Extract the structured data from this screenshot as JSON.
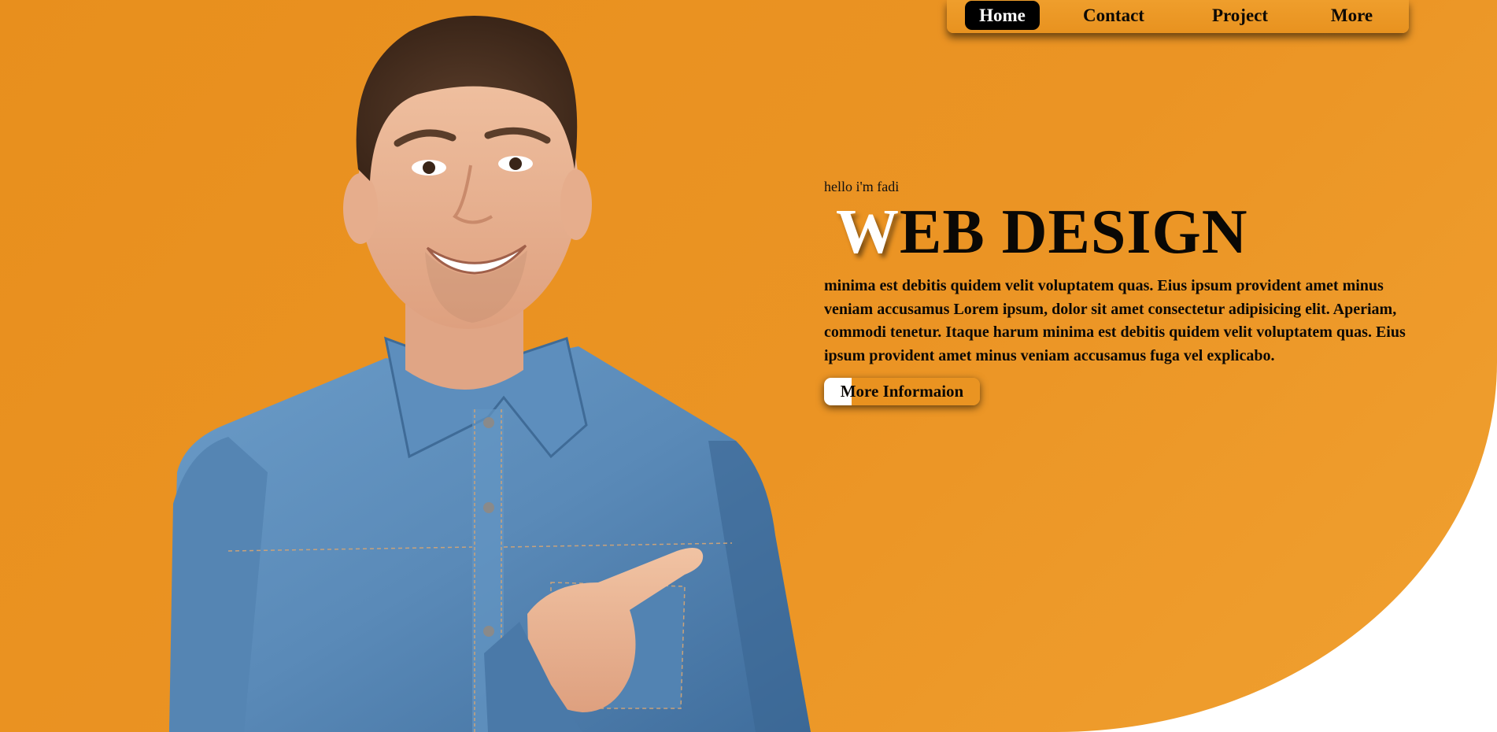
{
  "colors": {
    "accent_orange": "#eb9424",
    "nav_active_bg": "#000000",
    "nav_active_text": "#ffffff",
    "text_dark": "#0c0905",
    "page_bg": "#ffffff"
  },
  "nav": {
    "items": [
      {
        "label": "Home",
        "active": true
      },
      {
        "label": "Contact",
        "active": false
      },
      {
        "label": "Project",
        "active": false
      },
      {
        "label": "More",
        "active": false
      }
    ]
  },
  "hero": {
    "greeting": "hello i'm fadi",
    "headline_first_letter": "W",
    "headline_rest": "EB DESIGN",
    "body": "minima est debitis quidem velit voluptatem quas. Eius ipsum provident amet minus veniam accusamus Lorem ipsum, dolor sit amet consectetur adipisicing elit. Aperiam, commodi tenetur. Itaque harum minima est debitis quidem velit voluptatem quas. Eius ipsum provident amet minus veniam accusamus fuga vel explicabo.",
    "cta_label": "More Informaion"
  },
  "image": {
    "subject": "person-pointing-photo"
  }
}
